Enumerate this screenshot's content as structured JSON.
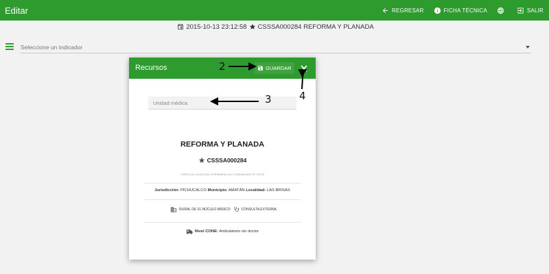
{
  "appbar": {
    "title": "Editar",
    "actions": [
      {
        "label": "REGRESAR",
        "icon": "arrow-left-icon"
      },
      {
        "label": "FICHA TÉCNICA",
        "icon": "info-icon"
      },
      {
        "label": "",
        "icon": "globe-icon"
      },
      {
        "label": "SALIR",
        "icon": "exit-icon"
      }
    ],
    "color": "#2e9b2e"
  },
  "subheader": {
    "datetime": "2015-10-13 23:12:58",
    "clues": "CSSSA000284 REFORMA Y PLANADA"
  },
  "indicator": {
    "placeholder": "Seleccione un indicador"
  },
  "dialog": {
    "title": "Recursos",
    "save_label": "GUARDAR",
    "unit_placeholder": "Unidad médica",
    "place_name": "REFORMA Y PLANADA",
    "clues": "CSSSA000284",
    "address": "CERCA DE LA ESCUELA PRIMARIA LAS 3 GARANTIAS CP. 29700",
    "jurisdiccion_label": "Jurisdicción:",
    "jurisdiccion": "PICHUCALCO",
    "municipio_label": "Municipio:",
    "municipio": "AMATÁN",
    "localidad_label": "Localidad:",
    "localidad": "LAS BRISAS",
    "tipo": "RURAL DE 01 NÚCLEO BÁSICO",
    "servicio": "CONSULTA EXTERNA",
    "nivel_label": "Nivel CONE:",
    "nivel": "Ambulatorio sin doctor"
  },
  "annotations": {
    "n2": "2",
    "n3": "3",
    "n4": "4"
  }
}
